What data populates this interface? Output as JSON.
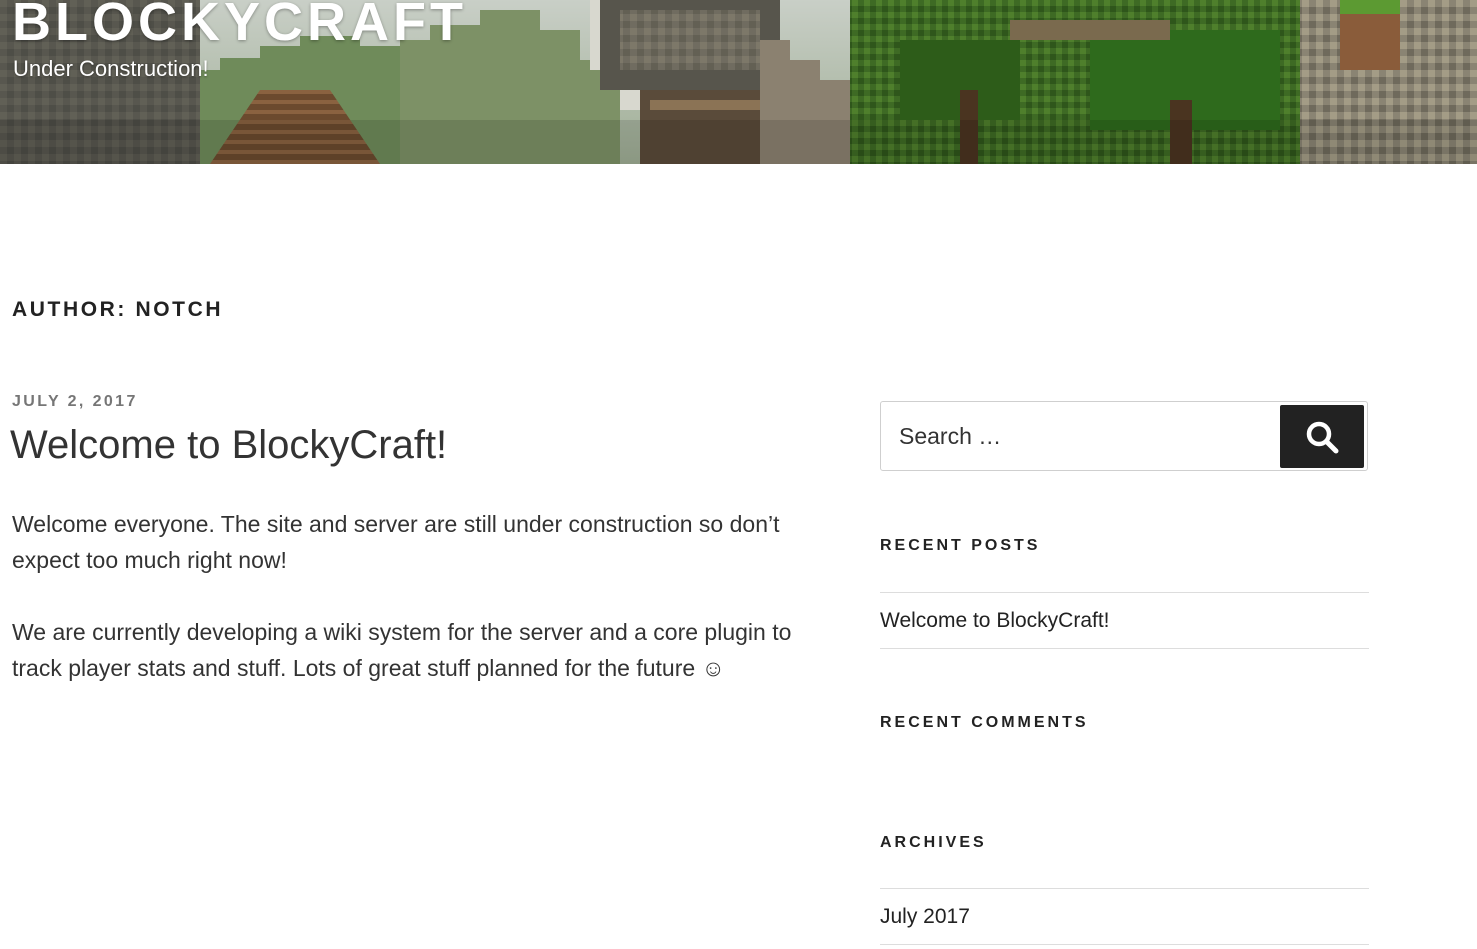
{
  "header": {
    "site_title": "BLOCKYCRAFT",
    "tagline": "Under Construction!"
  },
  "archive": {
    "title": "AUTHOR: NOTCH"
  },
  "post": {
    "date": "JULY 2, 2017",
    "title": "Welcome to BlockyCraft!",
    "paragraphs": [
      "Welcome everyone. The site and server are still under construction so don’t expect too much right now!",
      "We are currently developing a wiki system for the server and a core plugin to track player stats and stuff. Lots of great stuff planned for the future ☺"
    ]
  },
  "sidebar": {
    "search": {
      "placeholder": "Search …",
      "icon": "search-icon"
    },
    "recent_posts": {
      "title": "RECENT POSTS",
      "items": [
        "Welcome to BlockyCraft!"
      ]
    },
    "recent_comments": {
      "title": "RECENT COMMENTS"
    },
    "archives": {
      "title": "ARCHIVES",
      "items": [
        "July 2017"
      ]
    }
  },
  "colors": {
    "accent": "#222222",
    "meta": "#767676",
    "text": "#333333"
  }
}
